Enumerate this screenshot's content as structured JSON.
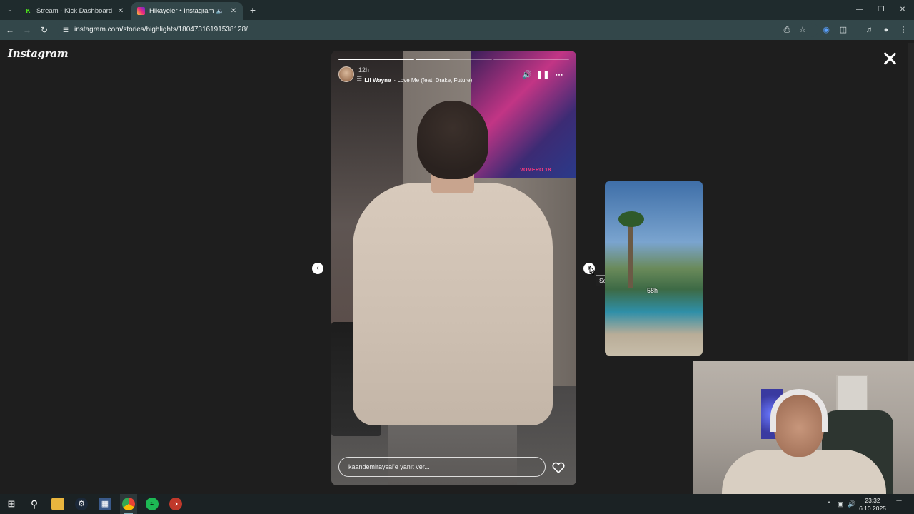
{
  "browser": {
    "tabs": [
      {
        "title": "Stream - Kick Dashboard",
        "icon": "kick-icon",
        "active": false
      },
      {
        "title": "Hikayeler • Instagram",
        "icon": "instagram-icon",
        "active": true
      }
    ],
    "url": "instagram.com/stories/highlights/18047316191538128/"
  },
  "page": {
    "logo_text": "Instagram",
    "story": {
      "time_ago": "12h",
      "music_artist": "Lil Wayne",
      "music_title": "· Love Me (feat. Drake, Future)",
      "screen_text": "VOMERO 18",
      "progress": [
        1.0,
        0.45,
        0.0
      ],
      "reply_placeholder": "kaandemiraysal'e yanıt ver..."
    },
    "nav_tooltip": "Sonraki",
    "preview_time": "58h"
  },
  "taskbar": {
    "time": "23:32",
    "date": "6.10.2025",
    "apps": [
      "windows-start-icon",
      "search-icon",
      "file-explorer-icon",
      "steam-icon",
      "store-icon",
      "chrome-icon",
      "spotify-icon",
      "app-icon"
    ]
  },
  "colors": {
    "instagram_gradient": [
      "#f9ce34",
      "#ee2a7b",
      "#6228d7"
    ],
    "kick_green": "#53fc18",
    "spotify_green": "#1db954"
  }
}
